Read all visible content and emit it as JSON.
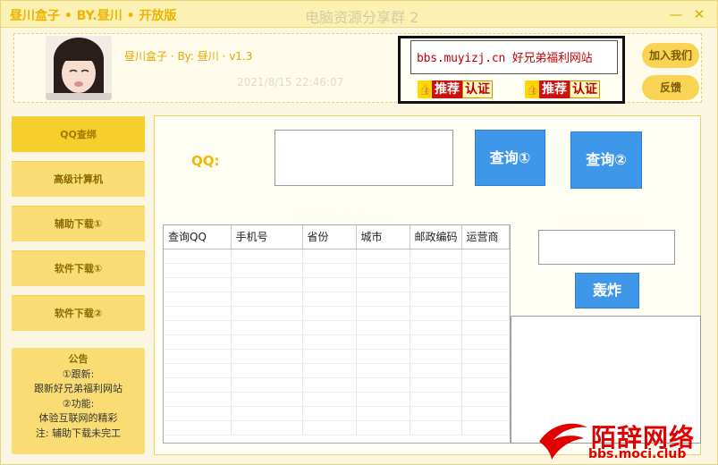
{
  "window": {
    "title": "昼川盒子 • BY.昼川 • 开放版",
    "ghost_title": "电脑资源分享群 2",
    "minimize_symbol": "—",
    "close_symbol": "✕"
  },
  "header": {
    "app_info": "昼川盒子 · By: 昼川 · v1.3",
    "ad_url": "bbs.muyizj.cn 好兄弟福利网站",
    "badges": [
      {
        "thumb_icon": "thumbs-up-icon",
        "recommend": "推荐",
        "certify": "认证"
      },
      {
        "thumb_icon": "thumbs-up-icon",
        "recommend": "推荐",
        "certify": "认证"
      }
    ],
    "join_label": "加入我们",
    "feedback_label": "反馈"
  },
  "sidebar": {
    "items": [
      {
        "label": "QQ查绑",
        "active": true
      },
      {
        "label": "高级计算机",
        "active": false
      },
      {
        "label": "辅助下载①",
        "active": false
      },
      {
        "label": "软件下载①",
        "active": false
      },
      {
        "label": "软件下载②",
        "active": false
      }
    ]
  },
  "notice": {
    "title": "公告",
    "lines": [
      "①跟新:",
      "跟新好兄弟福利网站",
      "②功能:",
      "体验互联网的精彩",
      "注: 辅助下载未完工"
    ]
  },
  "main": {
    "qq_label": "QQ:",
    "query1_label": "查询①",
    "query2_label": "查询②",
    "bomb_label": "轰炸",
    "table": {
      "columns": [
        "查询QQ",
        "手机号",
        "省份",
        "城市",
        "邮政编码",
        "运营商"
      ]
    }
  },
  "watermark": {
    "title": "陌辞网络",
    "url": "bbs.moci.club"
  },
  "colors": {
    "accent_yellow": "#f6cf2c",
    "button_blue": "#3e97e8",
    "watermark_red": "#e00000"
  }
}
